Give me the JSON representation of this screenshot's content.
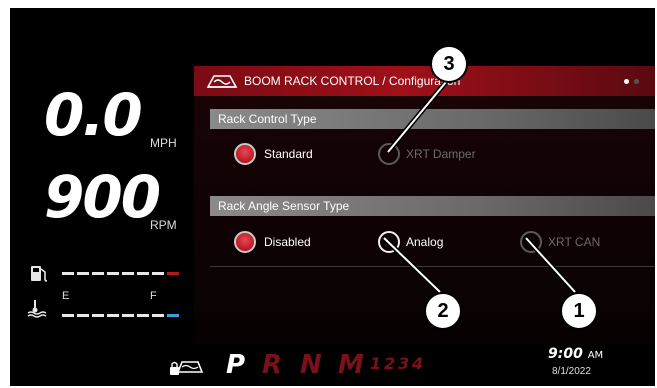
{
  "dash": {
    "speed": {
      "value": "0.0",
      "unit": "MPH"
    },
    "rpm": {
      "value": "900",
      "unit": "RPM"
    },
    "fuel": {
      "icon": "fuel-pump-icon"
    },
    "temp": {
      "icon": "coolant-temperature-icon",
      "empty": "E",
      "full": "F"
    }
  },
  "panel": {
    "icon": "boom-rack-icon",
    "title": "BOOM RACK CONTROL / Configuration",
    "page_dots": 2,
    "sections": [
      {
        "label": "Rack Control Type",
        "options": [
          {
            "label": "Standard",
            "state": "selected"
          },
          {
            "label": "XRT Damper",
            "state": "disabled"
          }
        ]
      },
      {
        "label": "Rack Angle Sensor Type",
        "options": [
          {
            "label": "Disabled",
            "state": "selected"
          },
          {
            "label": "Analog",
            "state": "available"
          },
          {
            "label": "XRT CAN",
            "state": "disabled"
          }
        ]
      }
    ]
  },
  "status": {
    "rack_icon": "boom-rack-lock-icon",
    "gears": [
      "P",
      "R",
      "N",
      "M",
      "1",
      "2",
      "3",
      "4"
    ],
    "active_gear": "P",
    "time": "9:00",
    "ampm": "AM",
    "date": "8/1/2022"
  },
  "callouts": [
    "3",
    "2",
    "1"
  ],
  "colors": {
    "accent": "#c8202c",
    "panel_bg": "#120305",
    "section_bar": "#7a7a7a",
    "temp_indicator": "#3aa0e0"
  }
}
